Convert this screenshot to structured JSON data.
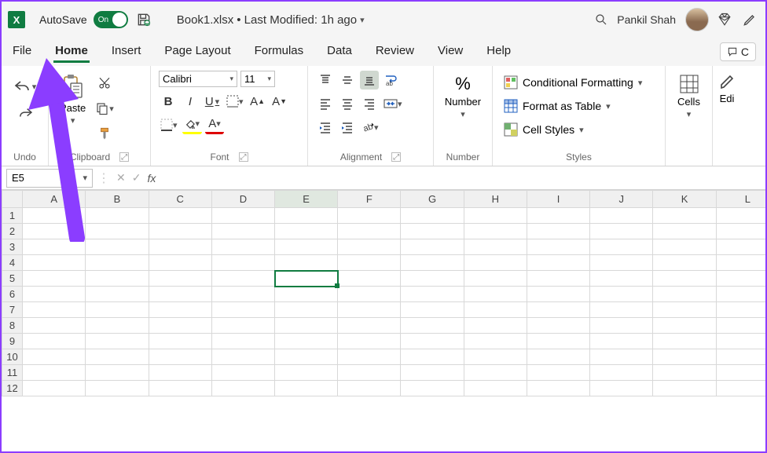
{
  "titlebar": {
    "autosave_label": "AutoSave",
    "autosave_state": "On",
    "doc_name": "Book1.xlsx",
    "doc_status": "• Last Modified: 1h ago",
    "user_name": "Pankil Shah"
  },
  "tabs": {
    "items": [
      "File",
      "Home",
      "Insert",
      "Page Layout",
      "Formulas",
      "Data",
      "Review",
      "View",
      "Help"
    ],
    "active": "Home",
    "comments_label": "C"
  },
  "ribbon": {
    "undo": {
      "label": "Undo"
    },
    "clipboard": {
      "paste_label": "Paste",
      "label": "Clipboard"
    },
    "font": {
      "name": "Calibri",
      "size": "11",
      "bold": "B",
      "italic": "I",
      "underline": "U",
      "label": "Font"
    },
    "alignment": {
      "label": "Alignment"
    },
    "number": {
      "big_label": "Number",
      "label": "Number"
    },
    "styles": {
      "conditional": "Conditional Formatting",
      "table": "Format as Table",
      "cell": "Cell Styles",
      "label": "Styles"
    },
    "cells": {
      "label": "Cells"
    },
    "editing": {
      "label": "Edi"
    }
  },
  "name_box": "E5",
  "columns": [
    "A",
    "B",
    "C",
    "D",
    "E",
    "F",
    "G",
    "H",
    "I",
    "J",
    "K",
    "L"
  ],
  "rows": [
    "1",
    "2",
    "3",
    "4",
    "5",
    "6",
    "7",
    "8",
    "9",
    "10",
    "11",
    "12"
  ],
  "selected": {
    "col": "E",
    "row": "5"
  }
}
